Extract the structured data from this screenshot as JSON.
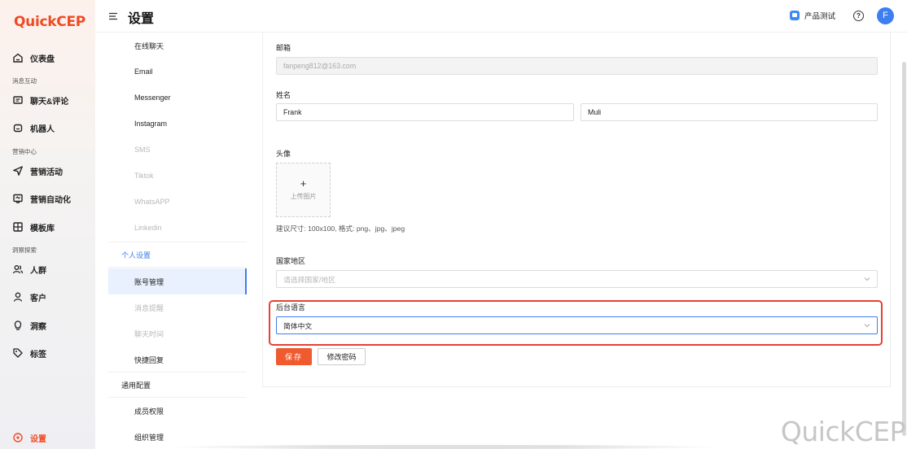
{
  "logo": {
    "q": "Q",
    "uick": "uick",
    "cep": "CEP"
  },
  "leftnav": {
    "dashboard": "仪表盘",
    "section_messaging": "消息互动",
    "chat": "聊天&评论",
    "bot": "机器人",
    "section_marketing": "营销中心",
    "campaign": "营销活动",
    "automation": "营销自动化",
    "templates": "模板库",
    "section_insight": "洞察探索",
    "audience": "人群",
    "customers": "客户",
    "insight": "洞察",
    "tags": "标签",
    "settings": "设置"
  },
  "header": {
    "title": "设置",
    "workspace": "产品测试",
    "help": "?",
    "avatar": "F"
  },
  "submenu": {
    "live_chat": "在线聊天",
    "email": "Email",
    "messenger": "Messenger",
    "instagram": "Instagram",
    "sms": "SMS",
    "tiktok": "Tiktok",
    "whatsapp": "WhatsAPP",
    "linkedin": "Linkedin",
    "group_personal": "个人设置",
    "account": "账号管理",
    "notifications": "消息提醒",
    "chat_time": "聊天时间",
    "quick_reply": "快捷回复",
    "group_general": "通用配置",
    "members": "成员权限",
    "org": "组织管理"
  },
  "form": {
    "email_label": "邮箱",
    "email_value": "fanpeng812@163.com",
    "name_label": "姓名",
    "first_name": "Frank",
    "last_name": "Muli",
    "avatar_label": "头像",
    "upload_plus": "+",
    "upload_text": "上传图片",
    "avatar_hint": "建议尺寸: 100x100, 格式: png、jpg、jpeg",
    "country_label": "国家地区",
    "country_placeholder": "请选择国家/地区",
    "language_label": "后台语言",
    "language_value": "简体中文",
    "save": "保存",
    "change_password": "修改密码"
  },
  "watermark": "QuickCEP",
  "colors": {
    "brand": "#ef4a23",
    "primary": "#3d7ef0",
    "highlight": "#e64135"
  }
}
